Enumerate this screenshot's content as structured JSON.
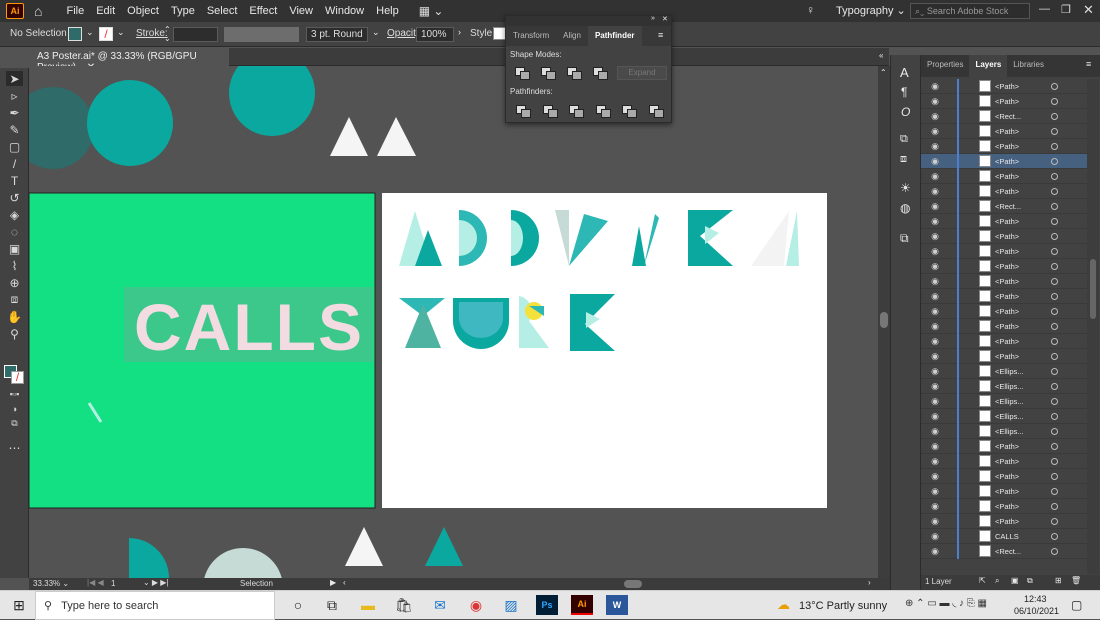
{
  "menubar": {
    "items": [
      "File",
      "Edit",
      "Object",
      "Type",
      "Select",
      "Effect",
      "View",
      "Window",
      "Help"
    ],
    "workspace": "Typography",
    "search_placeholder": "Search Adobe Stock"
  },
  "control": {
    "selection": "No Selection",
    "stroke_label": "Stroke:",
    "brush": "3 pt. Round",
    "opacity_label": "Opacity:",
    "opacity_value": "100%",
    "style_label": "Style:"
  },
  "document": {
    "tab_title": "A3 Poster.ai* @ 33.33% (RGB/GPU Preview)"
  },
  "artwork": {
    "calls_text": "CALLS",
    "green": "#12e083",
    "teal": "#0aa89e",
    "aqua": "#2db8b5",
    "mint": "#b5eee4",
    "pale": "#c6dad6",
    "yellow": "#f5e13b",
    "calls_fill": "#f2dbe1"
  },
  "pathfinder": {
    "tabs": [
      "Transform",
      "Align",
      "Pathfinder"
    ],
    "shape_modes_label": "Shape Modes:",
    "expand_label": "Expand",
    "pathfinders_label": "Pathfinders:"
  },
  "layers_panel": {
    "tabs": [
      "Properties",
      "Layers",
      "Libraries"
    ],
    "rows": [
      {
        "name": "<Path>",
        "sel": false
      },
      {
        "name": "<Path>",
        "sel": false
      },
      {
        "name": "<Rect...",
        "sel": false
      },
      {
        "name": "<Path>",
        "sel": false
      },
      {
        "name": "<Path>",
        "sel": false
      },
      {
        "name": "<Path>",
        "sel": true
      },
      {
        "name": "<Path>",
        "sel": false
      },
      {
        "name": "<Path>",
        "sel": false
      },
      {
        "name": "<Rect...",
        "sel": false
      },
      {
        "name": "<Path>",
        "sel": false
      },
      {
        "name": "<Path>",
        "sel": false
      },
      {
        "name": "<Path>",
        "sel": false
      },
      {
        "name": "<Path>",
        "sel": false
      },
      {
        "name": "<Path>",
        "sel": false
      },
      {
        "name": "<Path>",
        "sel": false
      },
      {
        "name": "<Path>",
        "sel": false
      },
      {
        "name": "<Path>",
        "sel": false
      },
      {
        "name": "<Path>",
        "sel": false
      },
      {
        "name": "<Path>",
        "sel": false
      },
      {
        "name": "<Ellips...",
        "sel": false
      },
      {
        "name": "<Ellips...",
        "sel": false
      },
      {
        "name": "<Ellips...",
        "sel": false
      },
      {
        "name": "<Ellips...",
        "sel": false
      },
      {
        "name": "<Ellips...",
        "sel": false
      },
      {
        "name": "<Path>",
        "sel": false
      },
      {
        "name": "<Path>",
        "sel": false
      },
      {
        "name": "<Path>",
        "sel": false
      },
      {
        "name": "<Path>",
        "sel": false
      },
      {
        "name": "<Path>",
        "sel": false
      },
      {
        "name": "<Path>",
        "sel": false
      },
      {
        "name": "CALLS",
        "sel": false
      },
      {
        "name": "<Rect...",
        "sel": false
      }
    ],
    "footer": "1 Layer"
  },
  "status": {
    "zoom": "33.33%",
    "artboard": "1",
    "tool": "Selection"
  },
  "taskbar": {
    "search_placeholder": "Type here to search",
    "weather": "13°C  Partly sunny",
    "time": "12:43",
    "date": "06/10/2021"
  }
}
